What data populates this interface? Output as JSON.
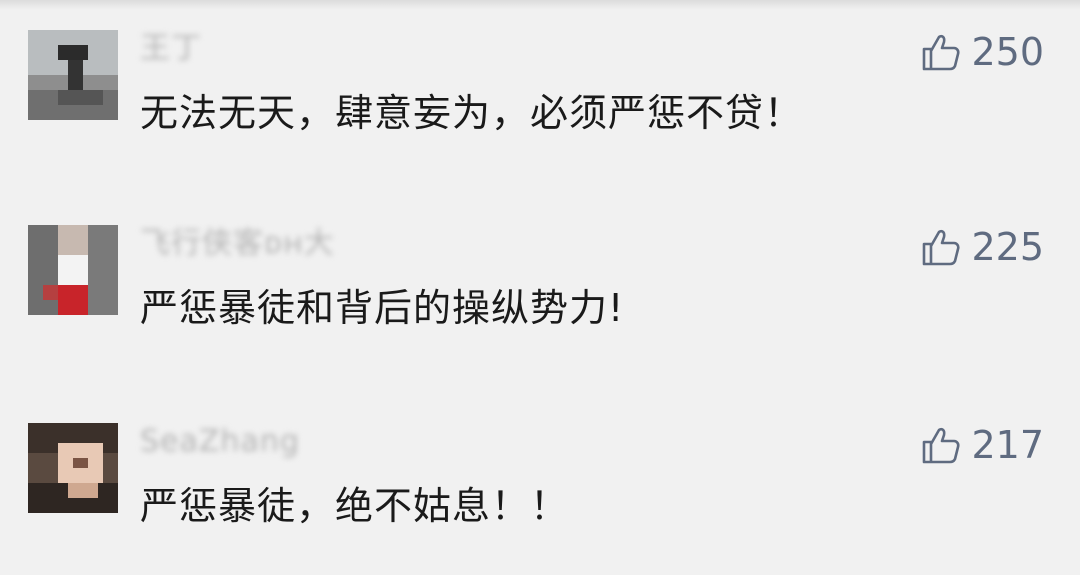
{
  "comments": [
    {
      "username": "王丁",
      "likes": "250",
      "text": "无法无天，肆意妄为，必须严惩不贷！",
      "avatar_icon": "avatar-statue"
    },
    {
      "username": "飞行侠客ᴅʜ大",
      "likes": "225",
      "text": "严惩暴徒和背后的操纵势力!",
      "avatar_icon": "avatar-person-red"
    },
    {
      "username": "SeaZhang",
      "likes": "217",
      "text": "严惩暴徒，绝不姑息！！",
      "avatar_icon": "avatar-face"
    }
  ],
  "icons": {
    "like": "thumbs-up-icon"
  },
  "colors": {
    "background": "#f1f1f1",
    "like": "#5f6b80",
    "text": "#1a1a1a",
    "username": "#b4b4b4"
  }
}
